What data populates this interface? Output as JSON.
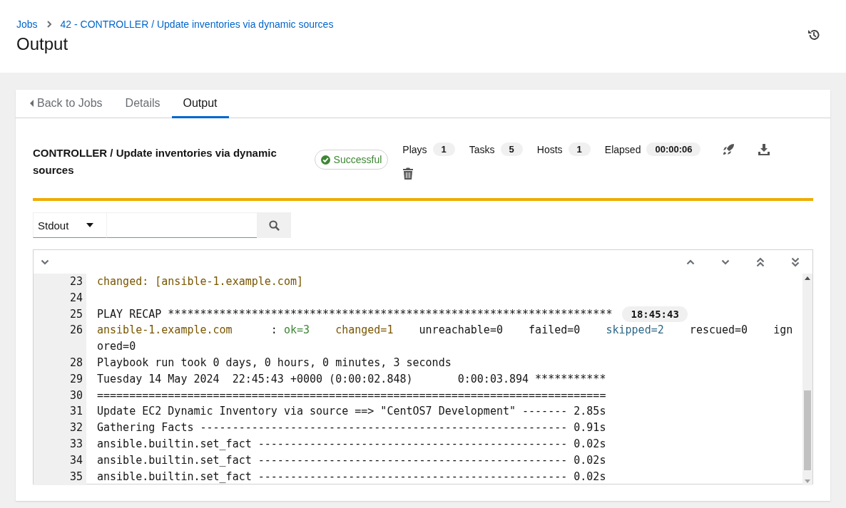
{
  "breadcrumb": [
    {
      "label": "Jobs"
    },
    {
      "label": "42 - CONTROLLER / Update inventories via dynamic sources"
    }
  ],
  "title": "Output",
  "tabs": [
    {
      "label": "Back to Jobs",
      "kind": "back",
      "selected": false
    },
    {
      "label": "Details",
      "kind": "tab",
      "selected": false
    },
    {
      "label": "Output",
      "kind": "tab",
      "selected": true
    }
  ],
  "job": {
    "name": "CONTROLLER / Update inventories via dynamic sources",
    "status": "Successful",
    "counts": [
      {
        "label": "Plays",
        "value": "1"
      },
      {
        "label": "Tasks",
        "value": "5"
      },
      {
        "label": "Hosts",
        "value": "1"
      },
      {
        "label": "Elapsed",
        "value": "00:00:06"
      }
    ]
  },
  "filter": {
    "value": "Stdout"
  },
  "output": {
    "lines": [
      {
        "number": "23",
        "segments": [
          {
            "text": "changed: [ansible-1.example.com]",
            "kind": "changed"
          }
        ]
      },
      {
        "number": "24"
      },
      {
        "number": "25",
        "segments": [
          {
            "text": "PLAY RECAP *********************************************************************",
            "kind": "plain"
          }
        ],
        "time": "18:45:43"
      },
      {
        "number": "26",
        "segments": [
          {
            "text": "ansible-1.example.com",
            "kind": "changed"
          },
          {
            "text": "      : ",
            "kind": "plain"
          },
          {
            "text": "ok=3",
            "kind": "ok"
          },
          {
            "text": "    changed=1",
            "kind": "changed"
          },
          {
            "text": "    unreachable=0    failed=0    ",
            "kind": "plain"
          },
          {
            "text": "skipped=2",
            "kind": "skipped"
          },
          {
            "text": "    rescued=0    ignored=0",
            "kind": "plain"
          }
        ]
      },
      {
        "number": "28",
        "segments": [
          {
            "text": "Playbook run took 0 days, 0 hours, 0 minutes, 3 seconds",
            "kind": "plain"
          }
        ]
      },
      {
        "number": "29",
        "segments": [
          {
            "text": "Tuesday 14 May 2024  22:45:43 +0000 (0:00:02.848)       0:00:03.894 ***********",
            "kind": "plain"
          }
        ]
      },
      {
        "number": "30",
        "segments": [
          {
            "text": "===============================================================================",
            "kind": "plain"
          }
        ]
      },
      {
        "number": "31",
        "segments": [
          {
            "text": "Update EC2 Dynamic Inventory via source ==> \"CentOS7 Development\" ------- 2.85s",
            "kind": "plain"
          }
        ]
      },
      {
        "number": "32",
        "segments": [
          {
            "text": "Gathering Facts --------------------------------------------------------- 0.91s",
            "kind": "plain"
          }
        ]
      },
      {
        "number": "33",
        "segments": [
          {
            "text": "ansible.builtin.set_fact ------------------------------------------------ 0.02s",
            "kind": "plain"
          }
        ]
      },
      {
        "number": "34",
        "segments": [
          {
            "text": "ansible.builtin.set_fact ------------------------------------------------ 0.02s",
            "kind": "plain"
          }
        ]
      },
      {
        "number": "35",
        "segments": [
          {
            "text": "ansible.builtin.set_fact ------------------------------------------------ 0.02s",
            "kind": "plain"
          }
        ]
      }
    ]
  }
}
